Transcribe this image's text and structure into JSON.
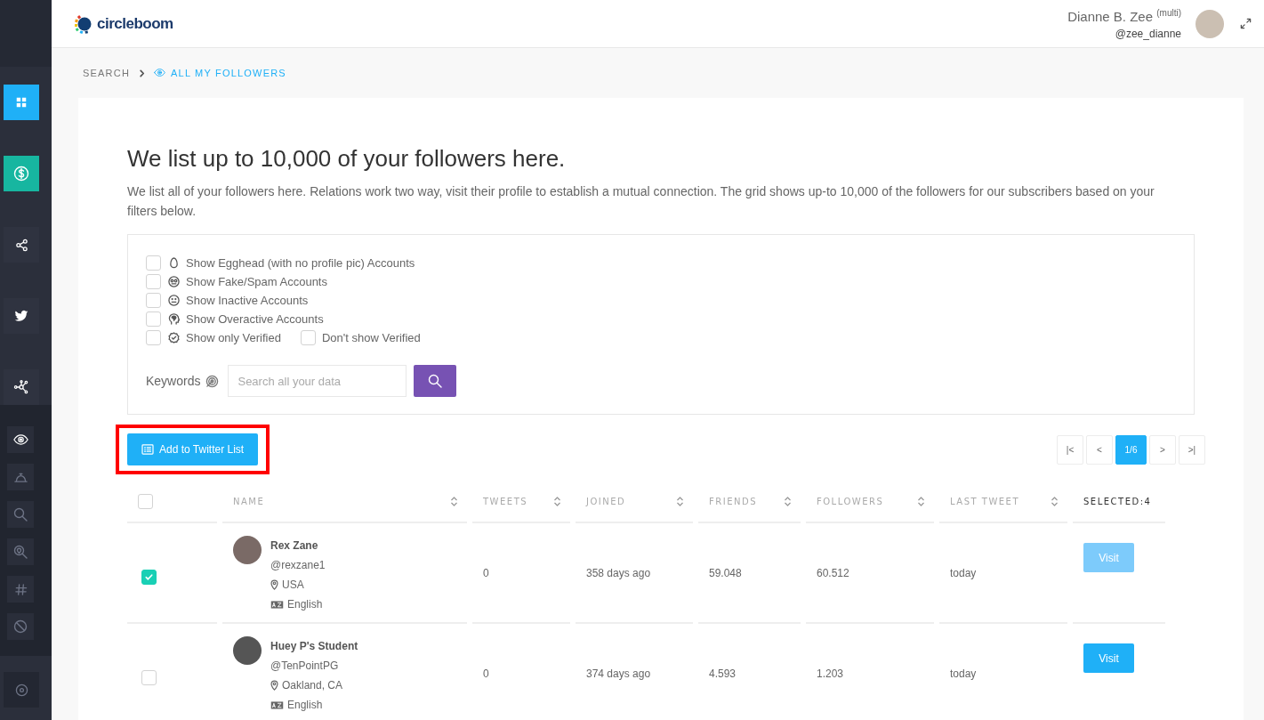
{
  "sidebar": {
    "top_items": [
      {
        "color": "#1fb0f7"
      },
      {
        "color": "#17b6a0"
      },
      {
        "color": "#2f3340"
      },
      {
        "color": "#2f3340"
      },
      {
        "color": "#2f3340"
      }
    ],
    "tool_items": [
      {
        "selected": true
      },
      {
        "selected": false
      },
      {
        "selected": false
      },
      {
        "selected": false
      },
      {
        "selected": false
      },
      {
        "selected": false
      }
    ]
  },
  "header": {
    "logo_text": "circleboom",
    "user_name": "Dianne B. Zee $^{(multi)}$",
    "user_handle": "@zee_dianne"
  },
  "breadcrumb": [
    {
      "label": "SEARCH",
      "current": false
    },
    {
      "label": "ALL MY FOLLOWERS",
      "current": true
    }
  ],
  "intro": {
    "title": "We list up to 10,000 of your followers here.",
    "description": "We list all of your followers here. Relations work two way, visit their profile to establish a mutual connection. The grid shows up-to 10,000 of the followers for our subscribers based on your filters below."
  },
  "filter_rows": [
    [
      {
        "label": "Show Egghead (with no profile pic) Accounts",
        "checked": false
      }
    ],
    [
      {
        "label": "Show Fake/Spam Accounts",
        "checked": false
      }
    ],
    [
      {
        "label": "Show Inactive Accounts",
        "checked": false
      }
    ],
    [
      {
        "label": "Show Overactive Accounts",
        "checked": false
      }
    ],
    [
      {
        "label": "Show only Verified",
        "checked": false
      },
      {
        "label": "Don't show Verified",
        "checked": false
      }
    ]
  ],
  "keywords": {
    "label": "Keywords",
    "placeholder": "Search all your data"
  },
  "add_button": {
    "label": "Add to Twitter List",
    "highlighted": true
  },
  "pager": [
    {
      "label": "|<",
      "selected": false
    },
    {
      "label": "<",
      "selected": false
    },
    {
      "label": "1/6",
      "selected": true
    },
    {
      "label": ">",
      "selected": false
    },
    {
      "label": ">|",
      "selected": false
    }
  ],
  "table": {
    "select_all_checked": false,
    "columns": [
      {
        "label": "NAME",
        "sortable": true
      },
      {
        "label": "TWEETS",
        "sortable": true
      },
      {
        "label": "JOINED",
        "sortable": true
      },
      {
        "label": "FRIENDS",
        "sortable": true
      },
      {
        "label": "FOLLOWERS",
        "sortable": true
      },
      {
        "label": "LAST TWEET",
        "sortable": true
      },
      {
        "label": "SELECTED:4",
        "sortable": false
      }
    ],
    "rows": [
      {
        "checked": true,
        "name": "Rex Zane",
        "handle": "@rexzane1",
        "location": "USA",
        "language": "English",
        "tweets": "0",
        "joined": "358 days ago",
        "friends": "59.048",
        "followers": "60.512",
        "last_tweet": "today",
        "visit": {
          "label": "Visit",
          "disabled": true
        }
      },
      {
        "checked": false,
        "name": "Huey P's Student",
        "handle": "@TenPointPG",
        "location": "Oakland, CA",
        "language": "English",
        "tweets": "0",
        "joined": "374 days ago",
        "friends": "4.593",
        "followers": "1.203",
        "last_tweet": "today",
        "visit": {
          "label": "Visit",
          "disabled": false
        }
      }
    ]
  }
}
